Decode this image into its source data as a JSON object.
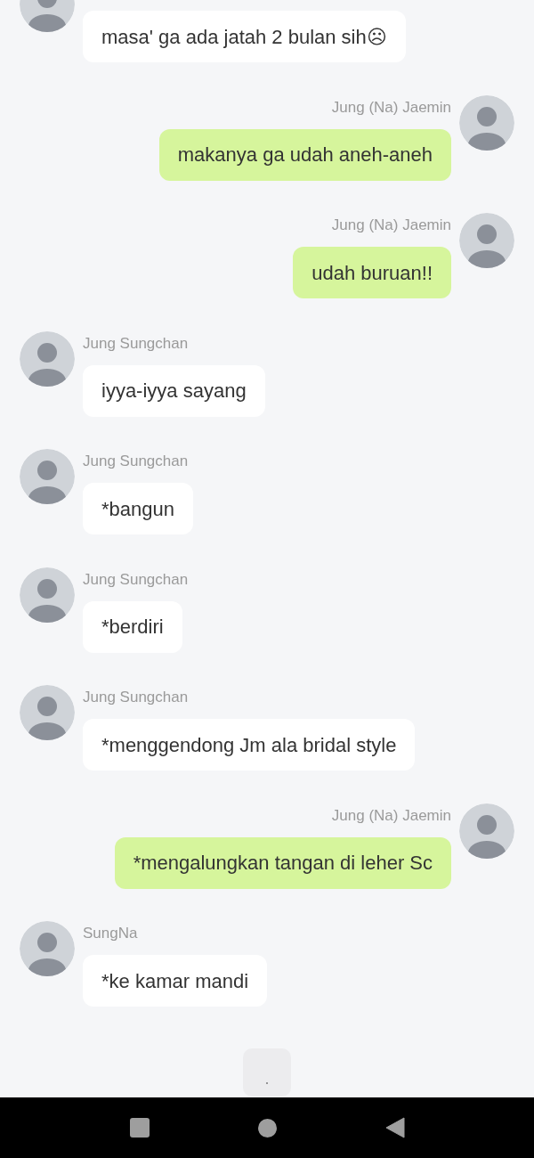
{
  "messages": [
    {
      "kind": "incoming",
      "text": "masa' ga ada jatah 2 bulan sih☹"
    },
    {
      "kind": "outgoing",
      "name": "Jung (Na) Jaemin",
      "text": "makanya ga udah aneh-aneh"
    },
    {
      "kind": "outgoing",
      "name": "Jung (Na) Jaemin",
      "text": "udah buruan!!"
    },
    {
      "kind": "incoming",
      "name": "Jung Sungchan",
      "text": "iyya-iyya sayang"
    },
    {
      "kind": "incoming",
      "name": "Jung Sungchan",
      "text": "*bangun"
    },
    {
      "kind": "incoming",
      "name": "Jung Sungchan",
      "text": "*berdiri"
    },
    {
      "kind": "incoming",
      "name": "Jung Sungchan",
      "text": "*menggendong Jm ala bridal style"
    },
    {
      "kind": "outgoing",
      "name": "Jung (Na) Jaemin",
      "text": "*mengalungkan tangan di leher Sc"
    },
    {
      "kind": "incoming",
      "name": "SungNa",
      "text": "*ke kamar mandi"
    }
  ],
  "typing_indicator": {
    "shown": true
  }
}
